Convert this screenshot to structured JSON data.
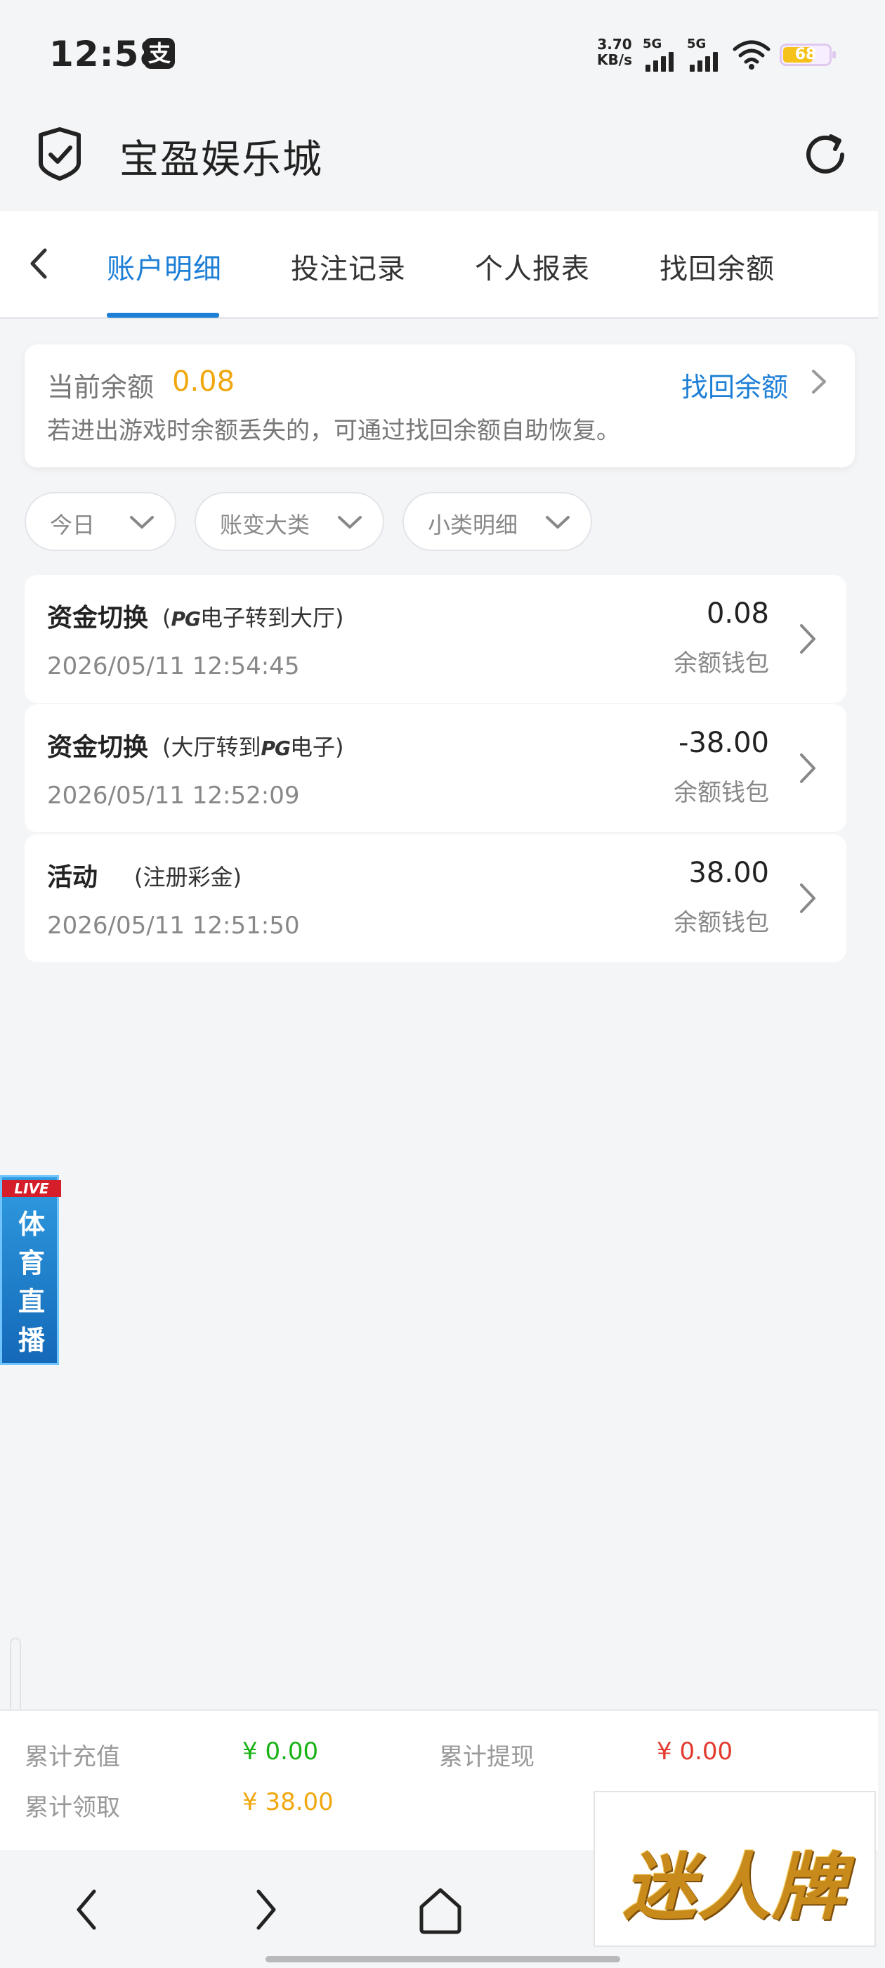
{
  "status_bar": {
    "time": "12:58",
    "net_speed_value": "3.70",
    "net_speed_unit": "KB/s",
    "signal1_label": "5G",
    "signal2_label": "5G",
    "battery_level": "68",
    "battery_fraction": 0.68
  },
  "app": {
    "title": "宝盈娱乐城"
  },
  "tabs": [
    {
      "label": "账户明细",
      "active": true
    },
    {
      "label": "投注记录",
      "active": false
    },
    {
      "label": "个人报表",
      "active": false
    },
    {
      "label": "找回余额",
      "active": false
    }
  ],
  "balance": {
    "label": "当前余额",
    "value": "0.08",
    "recover_link": "找回余额",
    "tip": "若进出游戏时余额丢失的，可通过找回余额自助恢复。"
  },
  "filters": [
    {
      "label": "今日"
    },
    {
      "label": "账变大类"
    },
    {
      "label": "小类明细"
    }
  ],
  "transactions": [
    {
      "type": "资金切换",
      "sub_open": "(",
      "sub_pg1": "",
      "sub_mid": "",
      "sub_pg2": "PG",
      "sub_end": "电子转到大厅)",
      "date": "2026/05/11 12:54:45",
      "amount": "0.08",
      "wallet": "余额钱包"
    },
    {
      "type": "资金切换",
      "sub_open": "(",
      "sub_pg1": "",
      "sub_mid": "大厅转到",
      "sub_pg2": "PG",
      "sub_end": "电子)",
      "date": "2026/05/11 12:52:09",
      "amount": "-38.00",
      "wallet": "余额钱包"
    },
    {
      "type": "活动",
      "sub_open": "(",
      "sub_pg1": "",
      "sub_mid": "注册彩金",
      "sub_pg2": "",
      "sub_end": ")",
      "date": "2026/05/11 12:51:50",
      "amount": "38.00",
      "wallet": "余额钱包"
    }
  ],
  "live_badge": {
    "live": "LIVE",
    "text": "体育直播"
  },
  "summary": {
    "recharge_label": "累计充值",
    "recharge_value": "¥ 0.00",
    "withdraw_label": "累计提现",
    "withdraw_value": "¥ 0.00",
    "claim_label": "累计领取",
    "claim_value": "¥ 38.00"
  },
  "brand_logo_text": "迷人牌",
  "colors": {
    "accent": "#1e7fd6",
    "balance": "#f0a70e",
    "positive": "#18b216",
    "negative": "#e23a2e"
  }
}
